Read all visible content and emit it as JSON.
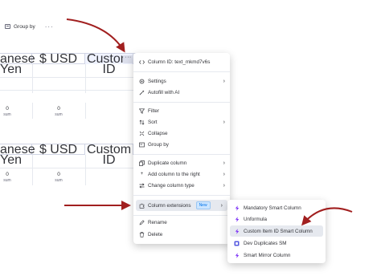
{
  "toolbar": {
    "group_by_label": "Group by",
    "more": "···"
  },
  "table1": {
    "headers": [
      "anese Yen",
      "$ USD",
      "Custom ID"
    ],
    "sums": [
      {
        "value": "0",
        "label": "sum"
      },
      {
        "value": "0",
        "label": "sum"
      }
    ]
  },
  "table2": {
    "headers": [
      "anese Yen",
      "$ USD",
      "Custom ID"
    ],
    "sums": [
      {
        "value": "0",
        "label": "sum"
      },
      {
        "value": "0",
        "label": "sum"
      }
    ]
  },
  "column_menu": {
    "more_button": "···",
    "column_id": "Column ID: text_mkmd7v6s",
    "settings": "Settings",
    "autofill": "Autofill with AI",
    "filter": "Filter",
    "sort": "Sort",
    "collapse": "Collapse",
    "group_by": "Group by",
    "duplicate": "Duplicate column",
    "add_right": "Add column to the right",
    "change_type": "Change column type",
    "extensions": "Column extensions",
    "new_badge": "New",
    "rename": "Rename",
    "delete": "Delete"
  },
  "extensions_submenu": {
    "items": [
      "Mandatory Smart Column",
      "Unformula",
      "Custom Item ID Smart Column",
      "Dev Duplicates SM",
      "Smart Mirror Column"
    ]
  },
  "colors": {
    "arrow": "#a11f1f",
    "accent_purple": "#7b2ff7",
    "highlight": "#e6e9ef",
    "badge_bg": "#cce5ff",
    "badge_text": "#0073ea"
  }
}
